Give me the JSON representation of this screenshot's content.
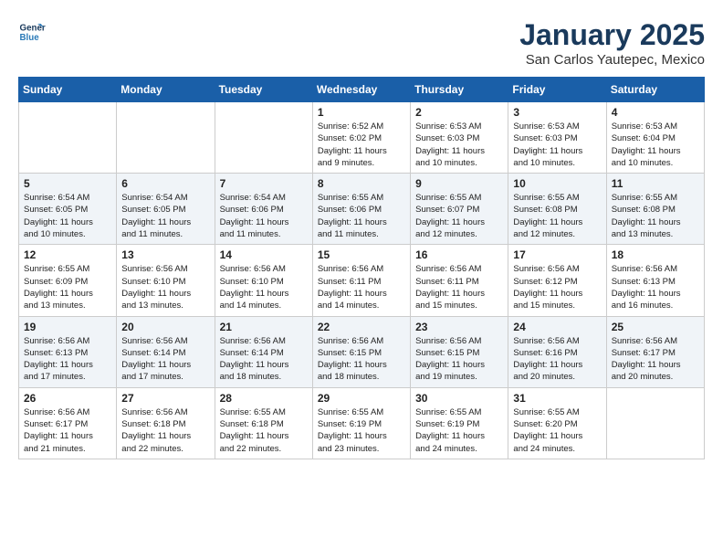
{
  "logo": {
    "line1": "General",
    "line2": "Blue"
  },
  "title": "January 2025",
  "location": "San Carlos Yautepec, Mexico",
  "days_of_week": [
    "Sunday",
    "Monday",
    "Tuesday",
    "Wednesday",
    "Thursday",
    "Friday",
    "Saturday"
  ],
  "weeks": [
    [
      {
        "day": "",
        "info": ""
      },
      {
        "day": "",
        "info": ""
      },
      {
        "day": "",
        "info": ""
      },
      {
        "day": "1",
        "info": "Sunrise: 6:52 AM\nSunset: 6:02 PM\nDaylight: 11 hours\nand 9 minutes."
      },
      {
        "day": "2",
        "info": "Sunrise: 6:53 AM\nSunset: 6:03 PM\nDaylight: 11 hours\nand 10 minutes."
      },
      {
        "day": "3",
        "info": "Sunrise: 6:53 AM\nSunset: 6:03 PM\nDaylight: 11 hours\nand 10 minutes."
      },
      {
        "day": "4",
        "info": "Sunrise: 6:53 AM\nSunset: 6:04 PM\nDaylight: 11 hours\nand 10 minutes."
      }
    ],
    [
      {
        "day": "5",
        "info": "Sunrise: 6:54 AM\nSunset: 6:05 PM\nDaylight: 11 hours\nand 10 minutes."
      },
      {
        "day": "6",
        "info": "Sunrise: 6:54 AM\nSunset: 6:05 PM\nDaylight: 11 hours\nand 11 minutes."
      },
      {
        "day": "7",
        "info": "Sunrise: 6:54 AM\nSunset: 6:06 PM\nDaylight: 11 hours\nand 11 minutes."
      },
      {
        "day": "8",
        "info": "Sunrise: 6:55 AM\nSunset: 6:06 PM\nDaylight: 11 hours\nand 11 minutes."
      },
      {
        "day": "9",
        "info": "Sunrise: 6:55 AM\nSunset: 6:07 PM\nDaylight: 11 hours\nand 12 minutes."
      },
      {
        "day": "10",
        "info": "Sunrise: 6:55 AM\nSunset: 6:08 PM\nDaylight: 11 hours\nand 12 minutes."
      },
      {
        "day": "11",
        "info": "Sunrise: 6:55 AM\nSunset: 6:08 PM\nDaylight: 11 hours\nand 13 minutes."
      }
    ],
    [
      {
        "day": "12",
        "info": "Sunrise: 6:55 AM\nSunset: 6:09 PM\nDaylight: 11 hours\nand 13 minutes."
      },
      {
        "day": "13",
        "info": "Sunrise: 6:56 AM\nSunset: 6:10 PM\nDaylight: 11 hours\nand 13 minutes."
      },
      {
        "day": "14",
        "info": "Sunrise: 6:56 AM\nSunset: 6:10 PM\nDaylight: 11 hours\nand 14 minutes."
      },
      {
        "day": "15",
        "info": "Sunrise: 6:56 AM\nSunset: 6:11 PM\nDaylight: 11 hours\nand 14 minutes."
      },
      {
        "day": "16",
        "info": "Sunrise: 6:56 AM\nSunset: 6:11 PM\nDaylight: 11 hours\nand 15 minutes."
      },
      {
        "day": "17",
        "info": "Sunrise: 6:56 AM\nSunset: 6:12 PM\nDaylight: 11 hours\nand 15 minutes."
      },
      {
        "day": "18",
        "info": "Sunrise: 6:56 AM\nSunset: 6:13 PM\nDaylight: 11 hours\nand 16 minutes."
      }
    ],
    [
      {
        "day": "19",
        "info": "Sunrise: 6:56 AM\nSunset: 6:13 PM\nDaylight: 11 hours\nand 17 minutes."
      },
      {
        "day": "20",
        "info": "Sunrise: 6:56 AM\nSunset: 6:14 PM\nDaylight: 11 hours\nand 17 minutes."
      },
      {
        "day": "21",
        "info": "Sunrise: 6:56 AM\nSunset: 6:14 PM\nDaylight: 11 hours\nand 18 minutes."
      },
      {
        "day": "22",
        "info": "Sunrise: 6:56 AM\nSunset: 6:15 PM\nDaylight: 11 hours\nand 18 minutes."
      },
      {
        "day": "23",
        "info": "Sunrise: 6:56 AM\nSunset: 6:15 PM\nDaylight: 11 hours\nand 19 minutes."
      },
      {
        "day": "24",
        "info": "Sunrise: 6:56 AM\nSunset: 6:16 PM\nDaylight: 11 hours\nand 20 minutes."
      },
      {
        "day": "25",
        "info": "Sunrise: 6:56 AM\nSunset: 6:17 PM\nDaylight: 11 hours\nand 20 minutes."
      }
    ],
    [
      {
        "day": "26",
        "info": "Sunrise: 6:56 AM\nSunset: 6:17 PM\nDaylight: 11 hours\nand 21 minutes."
      },
      {
        "day": "27",
        "info": "Sunrise: 6:56 AM\nSunset: 6:18 PM\nDaylight: 11 hours\nand 22 minutes."
      },
      {
        "day": "28",
        "info": "Sunrise: 6:55 AM\nSunset: 6:18 PM\nDaylight: 11 hours\nand 22 minutes."
      },
      {
        "day": "29",
        "info": "Sunrise: 6:55 AM\nSunset: 6:19 PM\nDaylight: 11 hours\nand 23 minutes."
      },
      {
        "day": "30",
        "info": "Sunrise: 6:55 AM\nSunset: 6:19 PM\nDaylight: 11 hours\nand 24 minutes."
      },
      {
        "day": "31",
        "info": "Sunrise: 6:55 AM\nSunset: 6:20 PM\nDaylight: 11 hours\nand 24 minutes."
      },
      {
        "day": "",
        "info": ""
      }
    ]
  ]
}
